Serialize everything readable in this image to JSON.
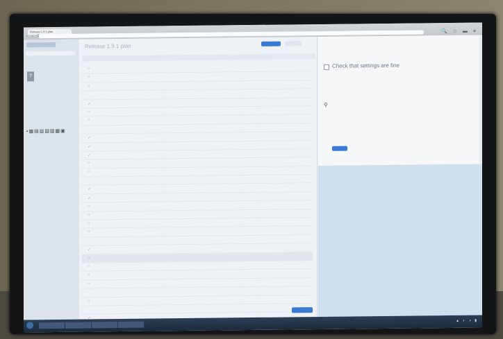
{
  "browser": {
    "tab_title": "Release 1.9.1 plan",
    "url": "",
    "nav_buttons": "‹ › ⟳",
    "toolbar_icons": "🔍 ☆ ▬ ≡"
  },
  "sidebar": {
    "logo": "",
    "user_lines": [
      "",
      "",
      ""
    ],
    "nav_items": [
      "",
      "",
      ""
    ],
    "icon_strip": "▪▦▤▥▧▨▩▣",
    "lower_items": [
      "",
      "",
      "",
      "",
      "",
      "",
      "",
      "",
      "",
      "",
      "",
      "",
      "",
      ""
    ],
    "footer": ""
  },
  "main": {
    "title": "Release 1.9.1 plan",
    "follow_label": "",
    "more_label": "",
    "toolbar_text": "",
    "rows": [
      {
        "type": "task",
        "check": "○",
        "text": ""
      },
      {
        "type": "task",
        "check": "○",
        "text": ""
      },
      {
        "type": "task",
        "check": "○",
        "text": ""
      },
      {
        "type": "section",
        "check": "",
        "text": ""
      },
      {
        "type": "task",
        "check": "✓",
        "text": ""
      },
      {
        "type": "task",
        "check": "○",
        "text": ""
      },
      {
        "type": "task",
        "check": "○",
        "text": ""
      },
      {
        "type": "section",
        "check": "",
        "text": ""
      },
      {
        "type": "task",
        "check": "✓",
        "text": ""
      },
      {
        "type": "task",
        "check": "✓",
        "text": ""
      },
      {
        "type": "task",
        "check": "✓",
        "text": ""
      },
      {
        "type": "task",
        "check": "○",
        "text": ""
      },
      {
        "type": "task",
        "check": "○",
        "text": ""
      },
      {
        "type": "section",
        "check": "",
        "text": ""
      },
      {
        "type": "task",
        "check": "✓",
        "text": ""
      },
      {
        "type": "task",
        "check": "✓",
        "text": ""
      },
      {
        "type": "task",
        "check": "○",
        "text": ""
      },
      {
        "type": "task",
        "check": "○",
        "text": ""
      },
      {
        "type": "task",
        "check": "○",
        "text": ""
      },
      {
        "type": "task",
        "check": "○",
        "text": ""
      },
      {
        "type": "section",
        "check": "",
        "text": ""
      },
      {
        "type": "task",
        "check": "✓",
        "text": ""
      },
      {
        "type": "task",
        "check": "○",
        "text": "",
        "selected": true
      },
      {
        "type": "task",
        "check": "○",
        "text": ""
      },
      {
        "type": "task",
        "check": "○",
        "text": ""
      },
      {
        "type": "task",
        "check": "○",
        "text": ""
      },
      {
        "type": "section",
        "check": "",
        "text": ""
      },
      {
        "type": "task",
        "check": "○",
        "text": ""
      },
      {
        "type": "section",
        "check": "",
        "text": ""
      },
      {
        "type": "task",
        "check": "✓",
        "text": ""
      }
    ],
    "footer_text": "",
    "footer_button": ""
  },
  "detail": {
    "toolbar_text": "",
    "task_title": "Check that settings are fine",
    "lines": [
      "",
      "",
      ""
    ],
    "comment_button": "",
    "footer_text": ""
  },
  "taskbar": {
    "items": [
      "",
      "",
      "",
      ""
    ],
    "tray": "▲ ◐ ◑ ▮"
  },
  "bezel_brand": ""
}
